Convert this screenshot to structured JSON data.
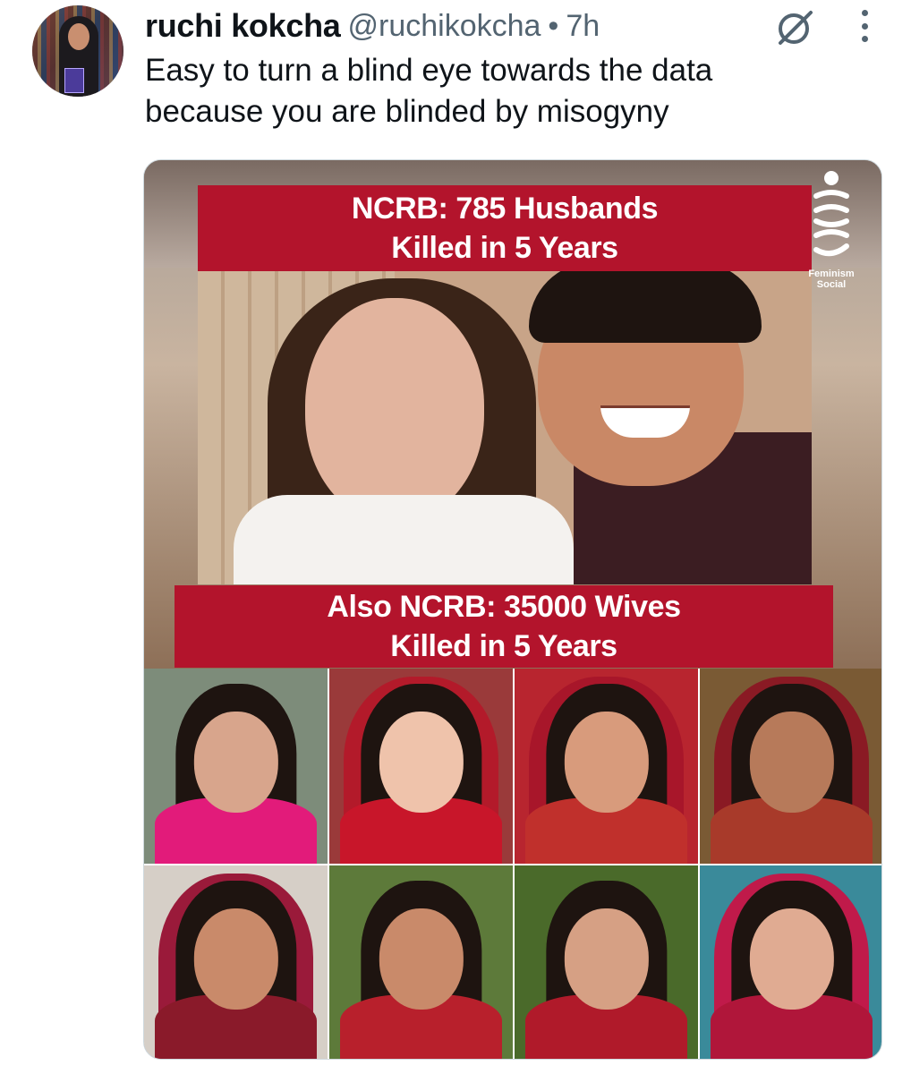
{
  "tweet": {
    "author_name": "ruchi kokcha",
    "handle": "@ruchikokcha",
    "separator": "•",
    "time": "7h",
    "text_lines": [
      "Easy to turn a blind eye towards the data",
      "because you are blinded by misogyny"
    ]
  },
  "media": {
    "banner_top": [
      "NCRB: 785 Husbands",
      "Killed in 5 Years"
    ],
    "banner_bottom": [
      "Also NCRB: 35000 Wives",
      "Killed in 5 Years"
    ],
    "logo_text": [
      "Feminism",
      "Social"
    ],
    "colors": {
      "banner": "#b3142c",
      "text": "#ffffff"
    },
    "tiles": [
      {
        "bg": "#7d8c7a",
        "skin": "#d8a58c",
        "outfit": "#e21b7a",
        "veil": ""
      },
      {
        "bg": "#9a3a3a",
        "skin": "#efc3ab",
        "outfit": "#c8162a",
        "veil": "#b31a2a"
      },
      {
        "bg": "#b8252f",
        "skin": "#d89b7c",
        "outfit": "#c0302c",
        "veil": "#a8162a"
      },
      {
        "bg": "#7a5a34",
        "skin": "#b77a5a",
        "outfit": "#a83a2a",
        "veil": "#8a1a24"
      },
      {
        "bg": "#d6cfc7",
        "skin": "#c98a6a",
        "outfit": "#8a1a2a",
        "veil": "#9a1a3a"
      },
      {
        "bg": "#5d7a3a",
        "skin": "#c98a6a",
        "outfit": "#b8202c",
        "veil": ""
      },
      {
        "bg": "#4a6a2a",
        "skin": "#d6a084",
        "outfit": "#b01a2a",
        "veil": ""
      },
      {
        "bg": "#3a8a9a",
        "skin": "#e0ab92",
        "outfit": "#b0163a",
        "veil": "#c01a4a"
      }
    ]
  },
  "icons": {
    "grok": "grok-icon",
    "more": "more-icon"
  }
}
